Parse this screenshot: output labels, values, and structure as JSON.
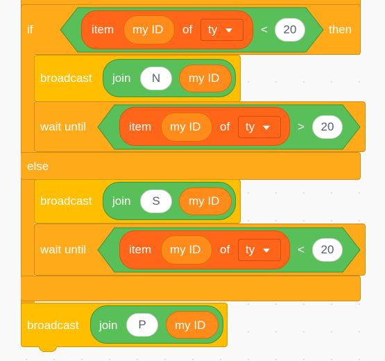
{
  "if_block": {
    "if_label": "if",
    "then_label": "then",
    "else_label": "else",
    "condition": {
      "op": "<",
      "value": "20",
      "item_label": "item",
      "of_label": "of",
      "index_reporter": "my ID",
      "list_name": "ty"
    }
  },
  "then_branch": {
    "broadcast": {
      "label": "broadcast",
      "join_label": "join",
      "first": "N",
      "second": "my ID"
    },
    "wait_until": {
      "label": "wait until",
      "item_label": "item",
      "index_reporter": "my ID",
      "of_label": "of",
      "list_name": "ty",
      "op": ">",
      "value": "20"
    }
  },
  "else_branch": {
    "broadcast": {
      "label": "broadcast",
      "join_label": "join",
      "first": "S",
      "second": "my ID"
    },
    "wait_until": {
      "label": "wait until",
      "item_label": "item",
      "index_reporter": "my ID",
      "of_label": "of",
      "list_name": "ty",
      "op": "<",
      "value": "20"
    }
  },
  "after_if": {
    "broadcast": {
      "label": "broadcast",
      "join_label": "join",
      "first": "P",
      "second": "my ID"
    }
  },
  "colors": {
    "control": "#ffab19",
    "events": "#ffbf00",
    "operators": "#59c059",
    "list_data": "#ff661a",
    "reporter": "#ff8c1a"
  }
}
